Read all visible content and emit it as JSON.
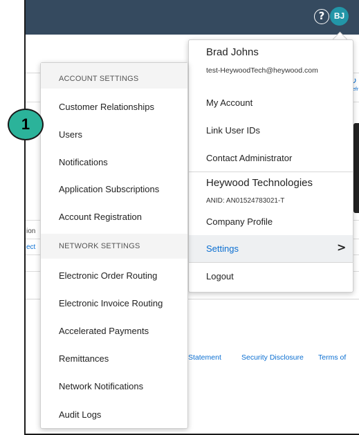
{
  "header": {
    "help_glyph": "?",
    "avatar_initials": "BJ",
    "background_color": "#354a5f",
    "avatar_color": "#2296a8"
  },
  "background": {
    "partial_text_1": "ion",
    "partial_link_1": "ect",
    "refresh_partial": "efr"
  },
  "footer": {
    "links": [
      "Statement",
      "Security Disclosure",
      "Terms of"
    ]
  },
  "profile_menu": {
    "name": "Brad Johns",
    "email": "test-HeywoodTech@heywood.com",
    "items": [
      "My Account",
      "Link User IDs",
      "Contact Administrator"
    ],
    "company": "Heywood Technologies",
    "anid": "ANID: AN01524783021-T",
    "company_profile": "Company Profile",
    "settings": "Settings",
    "settings_chevron": ">",
    "logout": "Logout"
  },
  "settings_menu": {
    "account_header": "ACCOUNT SETTINGS",
    "account_items": [
      "Customer Relationships",
      "Users",
      "Notifications",
      "Application Subscriptions",
      "Account Registration"
    ],
    "network_header": "NETWORK SETTINGS",
    "network_items": [
      "Electronic Order Routing",
      "Electronic Invoice Routing",
      "Accelerated Payments",
      "Remittances",
      "Network Notifications",
      "Audit Logs"
    ]
  },
  "callout": {
    "number": "1",
    "color": "#2bb39a"
  }
}
